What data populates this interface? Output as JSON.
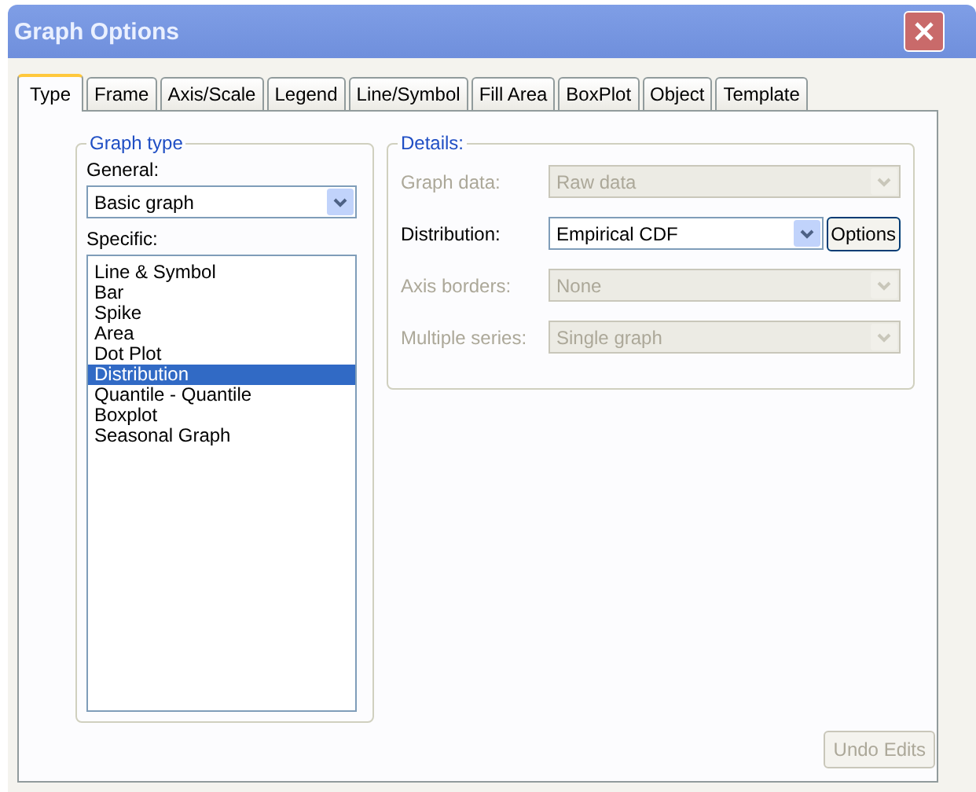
{
  "window": {
    "title": "Graph Options"
  },
  "tabs": [
    {
      "label": "Type",
      "selected": true
    },
    {
      "label": "Frame",
      "selected": false
    },
    {
      "label": "Axis/Scale",
      "selected": false
    },
    {
      "label": "Legend",
      "selected": false
    },
    {
      "label": "Line/Symbol",
      "selected": false
    },
    {
      "label": "Fill Area",
      "selected": false
    },
    {
      "label": "BoxPlot",
      "selected": false
    },
    {
      "label": "Object",
      "selected": false
    },
    {
      "label": "Template",
      "selected": false
    }
  ],
  "graph_type": {
    "title": "Graph type",
    "general_label": "General:",
    "general_value": "Basic graph",
    "specific_label": "Specific:",
    "specific_items": [
      {
        "label": "Line & Symbol",
        "selected": false
      },
      {
        "label": "Bar",
        "selected": false
      },
      {
        "label": "Spike",
        "selected": false
      },
      {
        "label": "Area",
        "selected": false
      },
      {
        "label": "Dot Plot",
        "selected": false
      },
      {
        "label": "Distribution",
        "selected": true
      },
      {
        "label": "Quantile - Quantile",
        "selected": false
      },
      {
        "label": "Boxplot",
        "selected": false
      },
      {
        "label": "Seasonal Graph",
        "selected": false
      }
    ]
  },
  "details": {
    "title": "Details:",
    "rows": [
      {
        "label": "Graph data:",
        "value": "Raw data",
        "disabled": true
      },
      {
        "label": "Distribution:",
        "value": "Empirical CDF",
        "disabled": false,
        "button": "Options"
      },
      {
        "label": "Axis borders:",
        "value": "None",
        "disabled": true
      },
      {
        "label": "Multiple series:",
        "value": "Single graph",
        "disabled": true
      }
    ]
  },
  "undo_button": {
    "label": "Undo Edits",
    "disabled": true
  }
}
